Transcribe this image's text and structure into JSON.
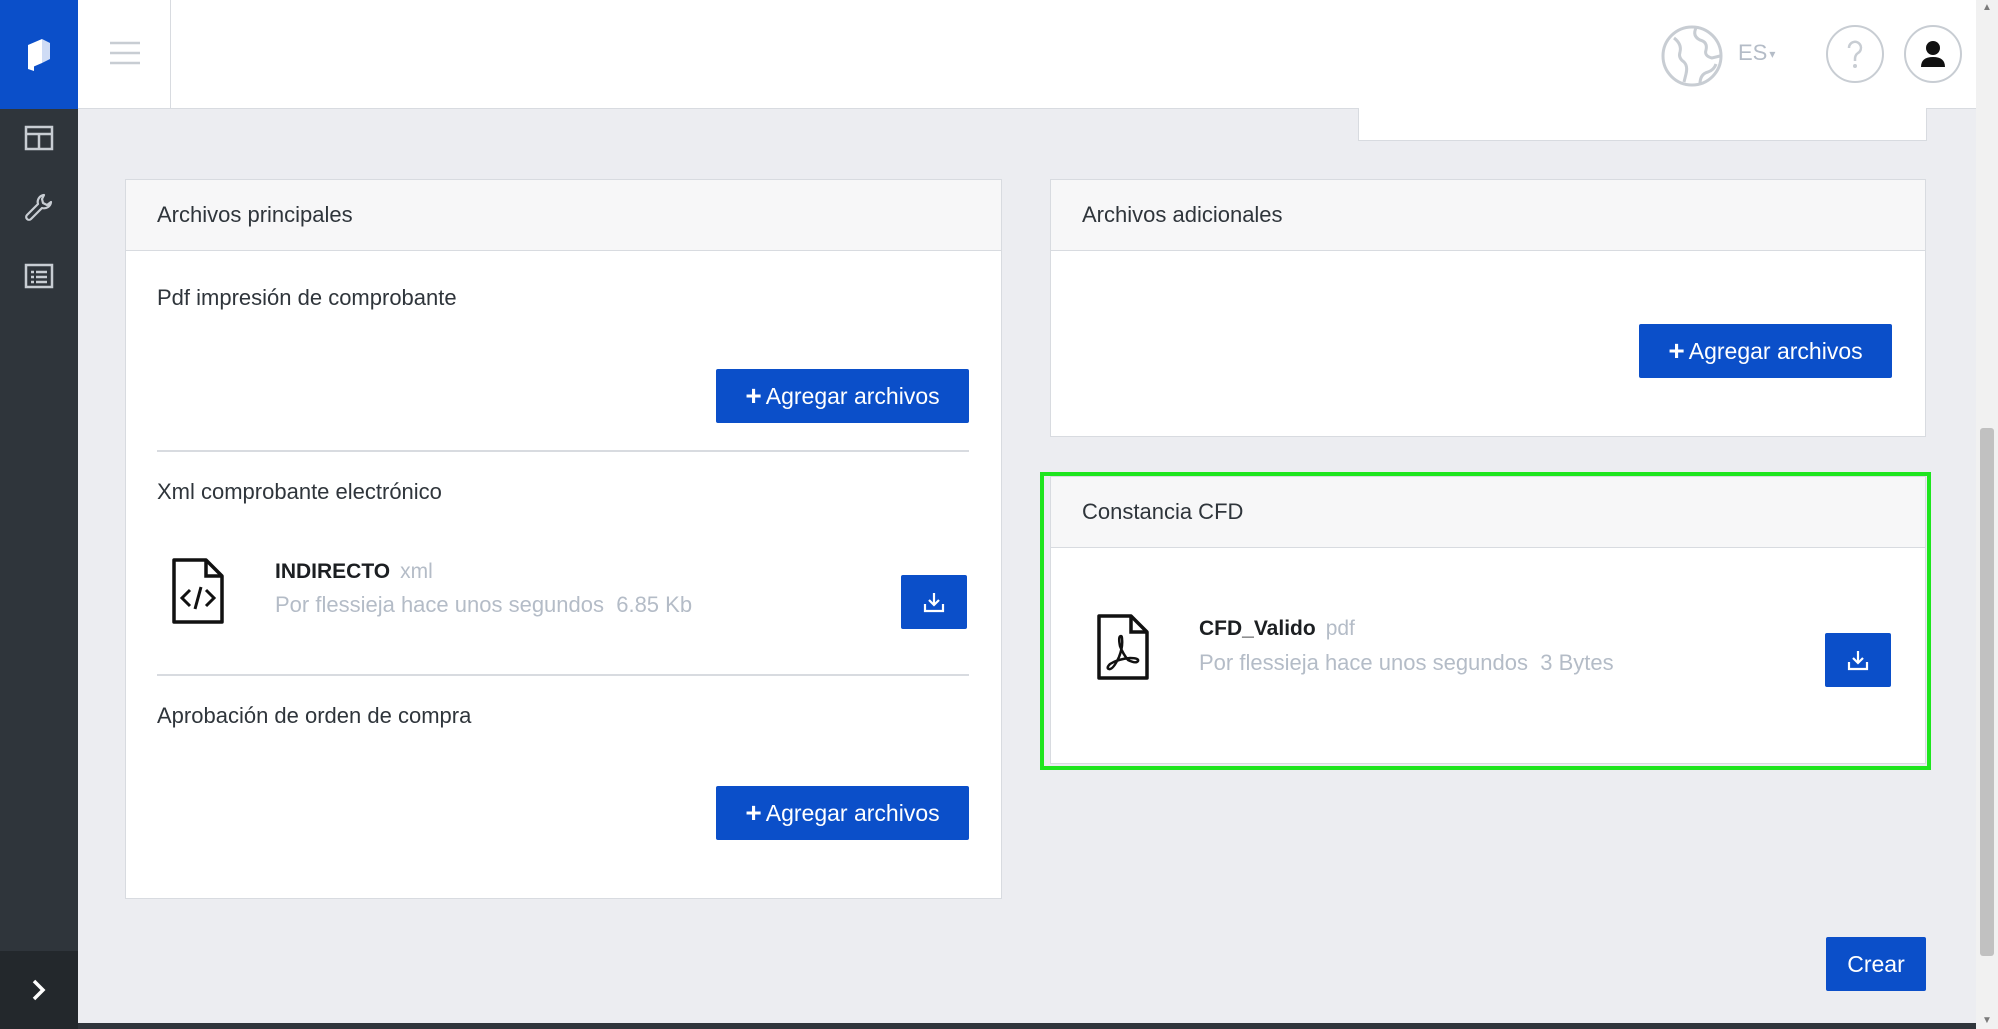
{
  "topbar": {
    "language": "ES"
  },
  "main_files": {
    "header": "Archivos principales",
    "sections": [
      {
        "title": "Pdf impresión de comprobante",
        "button": "Agregar archivos"
      },
      {
        "title": "Xml comprobante electrónico",
        "file": {
          "name": "INDIRECTO",
          "ext": "xml",
          "meta": "Por flessieja hace unos segundos  6.85 Kb",
          "icon": "file-code-icon"
        }
      },
      {
        "title": "Aprobación de orden de compra",
        "button": "Agregar archivos"
      }
    ]
  },
  "additional_files": {
    "header": "Archivos adicionales",
    "button": "Agregar archivos"
  },
  "constancia": {
    "header": "Constancia CFD",
    "file": {
      "name": "CFD_Valido",
      "ext": "pdf",
      "meta": "Por flessieja hace unos segundos  3 Bytes",
      "icon": "file-pdf-icon"
    }
  },
  "actions": {
    "create": "Crear"
  },
  "colors": {
    "primary": "#0b4fc9",
    "sidebar": "#2f353b",
    "highlight": "#1ee51e"
  }
}
